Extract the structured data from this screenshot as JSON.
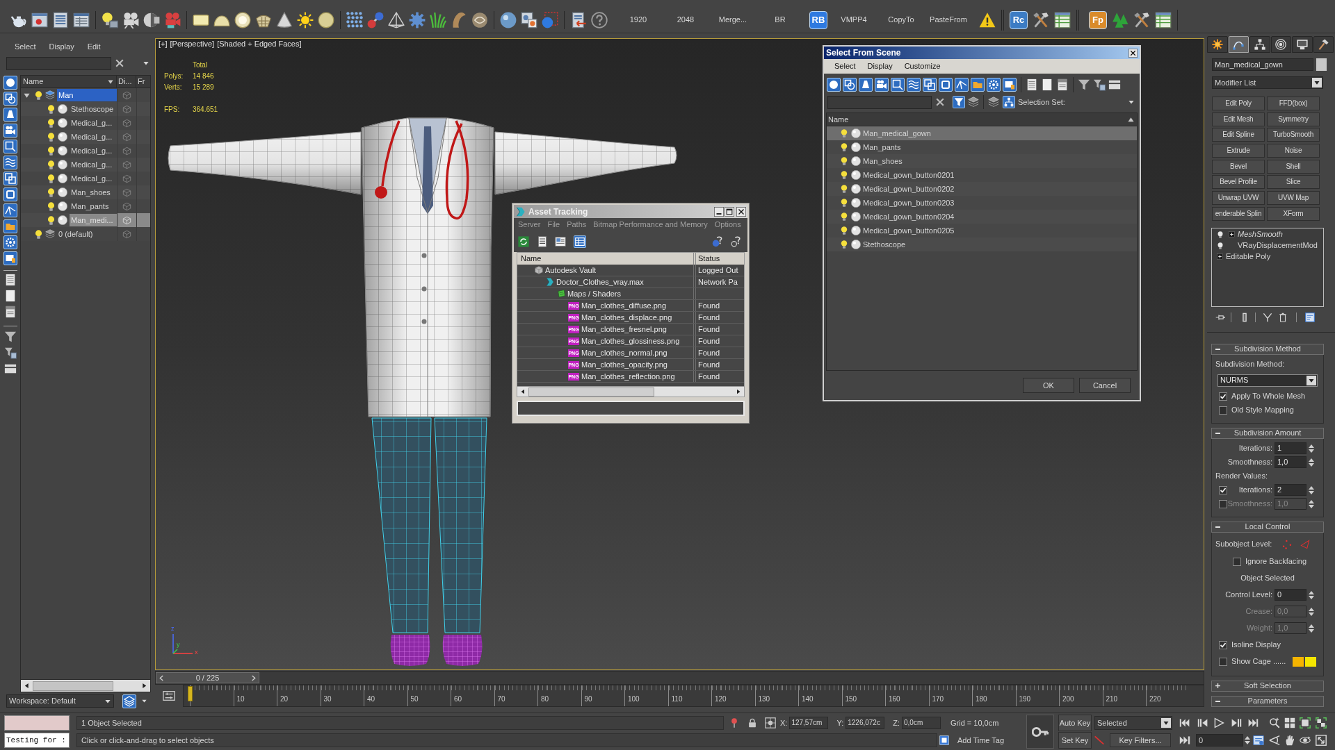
{
  "toolbar": {
    "buttons": [
      {
        "kind": "text",
        "label": "1920"
      },
      {
        "kind": "text",
        "label": "2048"
      },
      {
        "kind": "text",
        "label": "Merge..."
      },
      {
        "kind": "text",
        "label": "BR"
      },
      {
        "kind": "logo",
        "label": "RB",
        "color": "#2f7ae0"
      },
      {
        "kind": "text",
        "label": "VMPP4"
      },
      {
        "kind": "text",
        "label": "CopyTo"
      },
      {
        "kind": "text",
        "label": "PasteFrom"
      }
    ],
    "logos": [
      {
        "label": "Rc",
        "color": "#3c7cc4"
      },
      {
        "label": "Fp",
        "color": "#d98b2b"
      }
    ]
  },
  "scene_explorer": {
    "menu": [
      "Select",
      "Display",
      "Edit"
    ],
    "columns": [
      "Name",
      "Di...",
      "Fr"
    ],
    "tree": [
      {
        "name": "Man",
        "kind": "layer",
        "current": true,
        "selected": false,
        "expanded": true,
        "children": [
          {
            "name": "Stethoscope",
            "kind": "object",
            "current": false,
            "selected": false
          },
          {
            "name": "Medical_g...",
            "kind": "object",
            "current": false,
            "selected": false
          },
          {
            "name": "Medical_g...",
            "kind": "object",
            "current": false,
            "selected": false
          },
          {
            "name": "Medical_g...",
            "kind": "object",
            "current": false,
            "selected": false
          },
          {
            "name": "Medical_g...",
            "kind": "object",
            "current": false,
            "selected": false
          },
          {
            "name": "Medical_g...",
            "kind": "object",
            "current": false,
            "selected": false
          },
          {
            "name": "Man_shoes",
            "kind": "object",
            "current": false,
            "selected": false
          },
          {
            "name": "Man_pants",
            "kind": "object",
            "current": false,
            "selected": false
          },
          {
            "name": "Man_medi...",
            "kind": "object",
            "current": false,
            "selected": true
          }
        ]
      },
      {
        "name": "0 (default)",
        "kind": "layer",
        "current": false,
        "selected": false
      }
    ],
    "workspace": "Workspace: Default"
  },
  "viewport": {
    "active": true,
    "labels": [
      "[+]",
      "[Perspective]",
      "[Shaded + Edged Faces]"
    ],
    "stats_header": "Total",
    "stats": [
      {
        "label": "Polys:",
        "value": "14 846"
      },
      {
        "label": "Verts:",
        "value": "15 289"
      }
    ],
    "fps": {
      "label": "FPS:",
      "value": "364.651"
    },
    "axes": [
      "z",
      "y",
      "x"
    ]
  },
  "timeline": {
    "readout": "0 / 225",
    "level": 0,
    "ticks": [
      "10",
      "20",
      "30",
      "40",
      "50",
      "60",
      "70",
      "80",
      "90",
      "100",
      "110",
      "120",
      "130",
      "140",
      "150",
      "160",
      "170",
      "180",
      "190",
      "200",
      "210",
      "220"
    ]
  },
  "asset_tracking": {
    "title": "Asset Tracking",
    "menu": [
      "Server",
      "File",
      "Paths",
      "Bitmap Performance and Memory",
      "Options"
    ],
    "columns": [
      "Name",
      "Status"
    ],
    "rows": [
      {
        "kind": "vault",
        "name": "Autodesk Vault",
        "status": "Logged Out",
        "children": [
          {
            "kind": "max",
            "name": "Doctor_Clothes_vray.max",
            "status": "Network Pa",
            "children": [
              {
                "kind": "folder",
                "name": "Maps / Shaders",
                "children": [
                  {
                    "kind": "png",
                    "badge": "PNG",
                    "name": "Man_clothes_diffuse.png",
                    "status": "Found"
                  },
                  {
                    "kind": "png",
                    "badge": "PNG",
                    "name": "Man_clothes_displace.png",
                    "status": "Found"
                  },
                  {
                    "kind": "png",
                    "badge": "PNG",
                    "name": "Man_clothes_fresnel.png",
                    "status": "Found"
                  },
                  {
                    "kind": "png",
                    "badge": "PNG",
                    "name": "Man_clothes_glossiness.png",
                    "status": "Found"
                  },
                  {
                    "kind": "png",
                    "badge": "PNG",
                    "name": "Man_clothes_normal.png",
                    "status": "Found"
                  },
                  {
                    "kind": "png",
                    "badge": "PNG",
                    "name": "Man_clothes_opacity.png",
                    "status": "Found"
                  },
                  {
                    "kind": "png",
                    "badge": "PNG",
                    "name": "Man_clothes_reflection.png",
                    "status": "Found"
                  }
                ]
              }
            ]
          }
        ]
      }
    ]
  },
  "select_from_scene": {
    "title": "Select From Scene",
    "menu": [
      "Select",
      "Display",
      "Customize"
    ],
    "selection_set": "Selection Set:",
    "column": "Name",
    "rows": [
      {
        "name": "Man_medical_gown",
        "selected": true
      },
      {
        "name": "Man_pants",
        "selected": false
      },
      {
        "name": "Man_shoes",
        "selected": false
      },
      {
        "name": "Medical_gown_button0201",
        "selected": false
      },
      {
        "name": "Medical_gown_button0202",
        "selected": false
      },
      {
        "name": "Medical_gown_button0203",
        "selected": false
      },
      {
        "name": "Medical_gown_button0204",
        "selected": false
      },
      {
        "name": "Medical_gown_button0205",
        "selected": false
      },
      {
        "name": "Stethoscope",
        "selected": false
      }
    ],
    "buttons": [
      "OK",
      "Cancel"
    ]
  },
  "command_panel": {
    "tabs": [
      {
        "kind": "create",
        "selected": false
      },
      {
        "kind": "modify",
        "selected": true
      },
      {
        "kind": "hierarchy",
        "selected": false
      },
      {
        "kind": "motion",
        "selected": false
      },
      {
        "kind": "display",
        "selected": false
      },
      {
        "kind": "utilities",
        "selected": false
      }
    ],
    "object_name": "Man_medical_gown",
    "modifier_list": "Modifier List",
    "modifier_buttons": [
      "Edit Poly",
      "FFD(box)",
      "Edit Mesh",
      "Symmetry",
      "Edit Spline",
      "TurboSmooth",
      "Extrude",
      "Noise",
      "Bevel",
      "Shell",
      "Bevel Profile",
      "Slice",
      "Unwrap UVW",
      "UVW Map",
      "enderable Splin",
      "XForm"
    ],
    "stack": [
      {
        "name": "MeshSmooth",
        "kind": "modifier",
        "expandable": true,
        "off_in_render": true
      },
      {
        "name": "VRayDisplacementMod",
        "kind": "modifier",
        "expandable": false,
        "off_in_render": false
      },
      {
        "name": "Editable Poly",
        "kind": "base",
        "expandable": true,
        "off_in_render": false
      }
    ],
    "rollouts": [
      {
        "title": "Subdivision Method",
        "kind": "subdivision_method",
        "expanded": true,
        "controls": [
          {
            "kind": "label",
            "text": "Subdivision Method:"
          },
          {
            "kind": "dropdown",
            "value": "NURMS"
          },
          {
            "kind": "checkbox",
            "label": "Apply To Whole Mesh",
            "checked": true
          },
          {
            "kind": "checkbox",
            "label": "Old Style Mapping",
            "checked": false
          }
        ]
      },
      {
        "title": "Subdivision Amount",
        "kind": "subdivision_amount",
        "expanded": true,
        "controls": [
          {
            "kind": "spinner",
            "label": "Iterations:",
            "value": "1",
            "disabled": false
          },
          {
            "kind": "spinner",
            "label": "Smoothness:",
            "value": "1,0",
            "disabled": false
          },
          {
            "kind": "label",
            "text": "Render Values:"
          },
          {
            "kind": "check_spinner",
            "label": "Iterations:",
            "value": "2",
            "checked": true,
            "disabled": false
          },
          {
            "kind": "check_spinner",
            "label": "Smoothness:",
            "value": "1,0",
            "checked": false,
            "disabled": true
          }
        ]
      },
      {
        "title": "Local Control",
        "kind": "local_control",
        "expanded": true,
        "controls": [
          {
            "kind": "subobject",
            "label": "Subobject Level:"
          },
          {
            "kind": "centered_checkbox",
            "label": "Ignore Backfacing",
            "checked": false
          },
          {
            "kind": "caption",
            "text": "Object Selected"
          },
          {
            "kind": "spinner",
            "label": "Control Level:",
            "value": "0",
            "disabled": false
          },
          {
            "kind": "spinner",
            "label": "Crease:",
            "value": "0,0",
            "disabled": true
          },
          {
            "kind": "spinner",
            "label": "Weight:",
            "value": "1,0",
            "disabled": true
          },
          {
            "kind": "checkbox",
            "label": "Isoline Display",
            "checked": true
          },
          {
            "kind": "swatches",
            "label": "Show Cage ......",
            "checked": false,
            "swatches": [
              {
                "color": "#f5b400"
              },
              {
                "color": "#f5e600"
              }
            ]
          }
        ]
      },
      {
        "title": "Soft Selection",
        "kind": "soft_selection",
        "expanded": false
      },
      {
        "title": "Parameters",
        "kind": "parameters",
        "expanded": true
      }
    ]
  },
  "status_bar": {
    "listener_input": "Testing for :",
    "selection": "1 Object Selected",
    "prompt": "Click or click-and-drag to select objects",
    "coordinates": [
      {
        "label": "X:",
        "value": "127,57cm"
      },
      {
        "label": "Y:",
        "value": "1226,072c"
      },
      {
        "label": "Z:",
        "value": "0,0cm"
      }
    ],
    "grid": "Grid = 10,0cm",
    "add_time_tag": "Add Time Tag",
    "auto_key": "Auto Key",
    "set_key": "Set Key",
    "key_set": "Selected",
    "key_filters": "Key Filters...",
    "frame": "0"
  }
}
